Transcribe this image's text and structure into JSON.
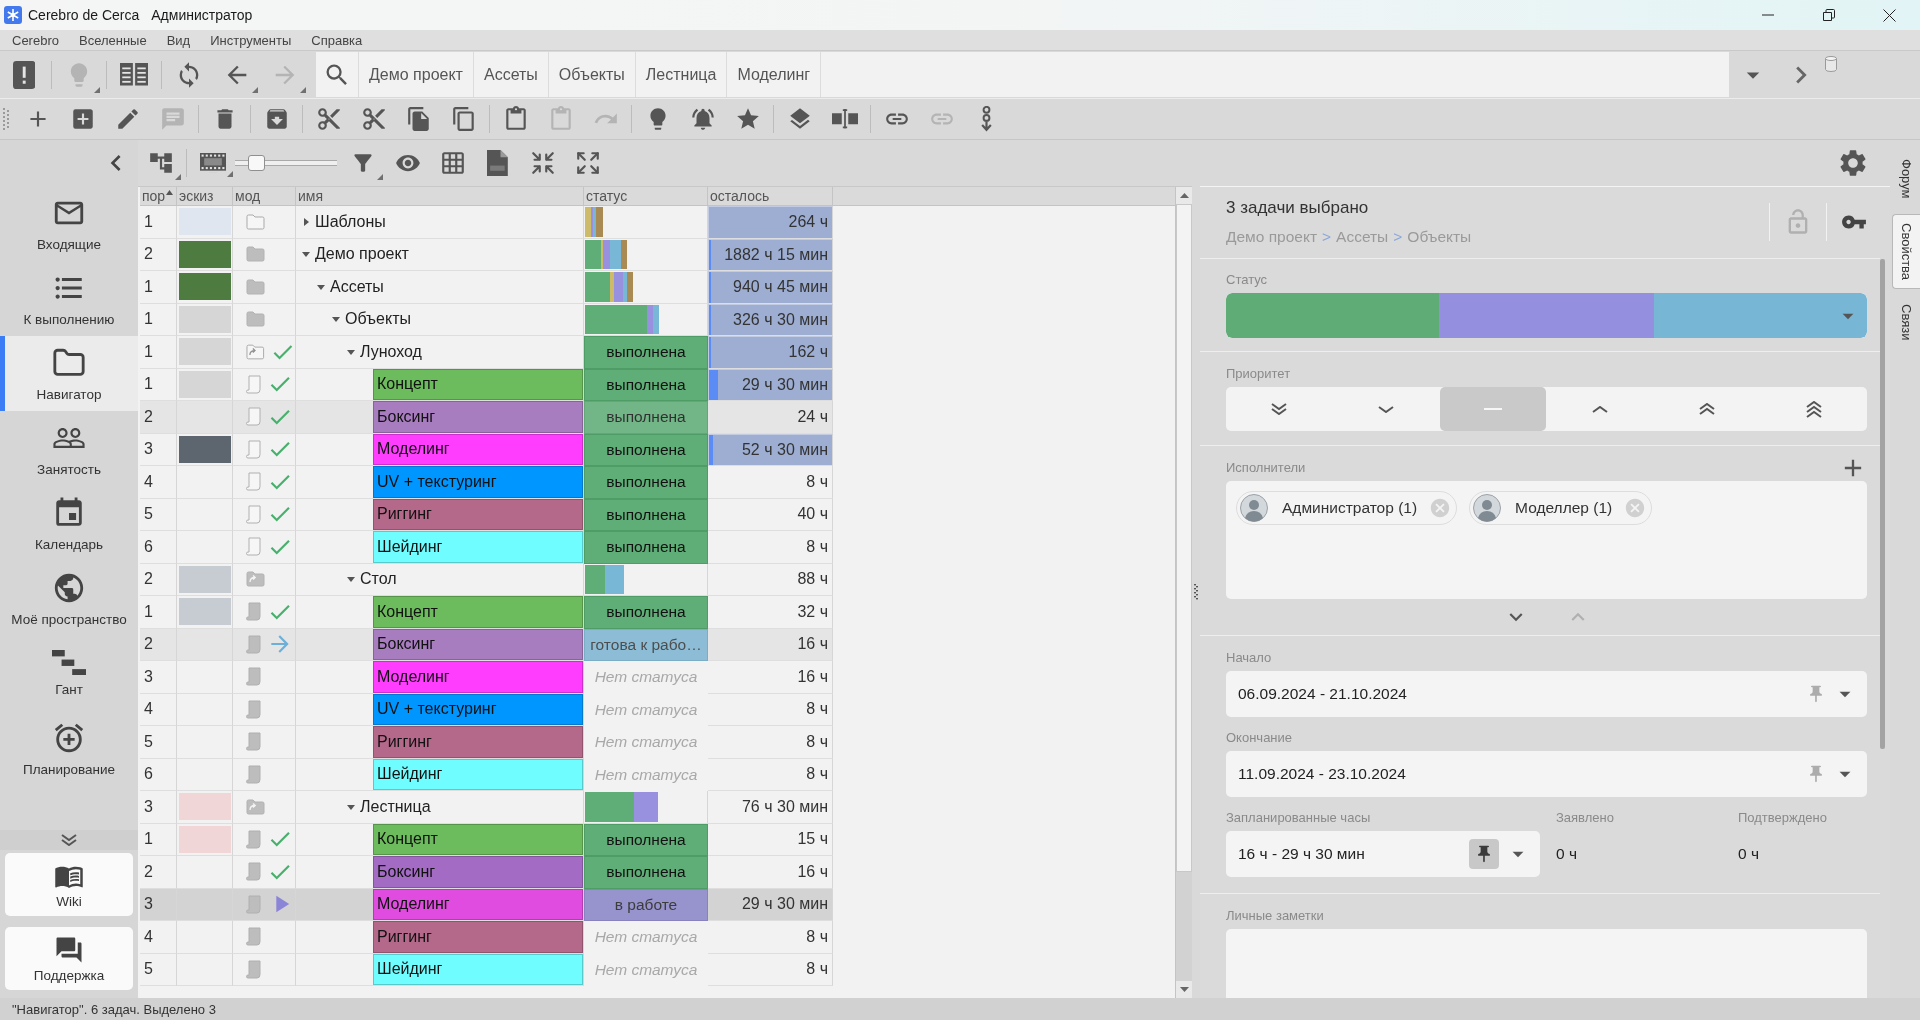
{
  "window": {
    "app_name": "Cerebro de Cerca",
    "user": "Администратор"
  },
  "menu": [
    "Cerebro",
    "Вселенные",
    "Вид",
    "Инструменты",
    "Справка"
  ],
  "nav_toolbar": {
    "groups": [
      [
        {
          "kind": "alert-book",
          "disabled": false,
          "dropdown": false
        }
      ],
      [
        {
          "kind": "bulb",
          "disabled": true,
          "dropdown": true
        }
      ],
      [
        {
          "kind": "reader",
          "disabled": false,
          "dropdown": false
        }
      ],
      [
        {
          "kind": "sync",
          "disabled": false,
          "dropdown": false
        },
        {
          "kind": "back",
          "disabled": false,
          "dropdown": true
        },
        {
          "kind": "forward",
          "disabled": true,
          "dropdown": true
        }
      ]
    ],
    "path": [
      "Демо проект",
      "Ассеты",
      "Объекты",
      "Лестница",
      "Моделинг"
    ]
  },
  "action_toolbar": {
    "groups": [
      [
        {
          "kind": "plus",
          "disabled": false,
          "dropdown": false
        },
        {
          "kind": "add-sub",
          "disabled": false,
          "dropdown": false
        },
        {
          "kind": "pencil",
          "disabled": false,
          "dropdown": false
        },
        {
          "kind": "comment",
          "disabled": true,
          "dropdown": false
        }
      ],
      [
        {
          "kind": "trash",
          "disabled": false,
          "dropdown": false
        }
      ],
      [
        {
          "kind": "archive",
          "disabled": false,
          "dropdown": false
        }
      ],
      [
        {
          "kind": "cut",
          "disabled": false,
          "dropdown": false
        },
        {
          "kind": "cut-move",
          "disabled": false,
          "dropdown": false
        },
        {
          "kind": "copy",
          "disabled": false,
          "dropdown": false
        },
        {
          "kind": "copy-link",
          "disabled": false,
          "dropdown": false
        }
      ],
      [
        {
          "kind": "paste",
          "disabled": false,
          "dropdown": false
        },
        {
          "kind": "paste-special",
          "disabled": true,
          "dropdown": false
        },
        {
          "kind": "redo",
          "disabled": true,
          "dropdown": false
        }
      ],
      [
        {
          "kind": "bulb",
          "disabled": false,
          "dropdown": false
        },
        {
          "kind": "bell",
          "disabled": false,
          "dropdown": false
        },
        {
          "kind": "star",
          "disabled": false,
          "dropdown": false
        }
      ],
      [
        {
          "kind": "stack",
          "disabled": false,
          "dropdown": false
        },
        {
          "kind": "split",
          "disabled": false,
          "dropdown": false
        }
      ],
      [
        {
          "kind": "link-add",
          "disabled": false,
          "dropdown": false
        },
        {
          "kind": "link",
          "disabled": true,
          "dropdown": false
        },
        {
          "kind": "chain-down",
          "disabled": false,
          "dropdown": false
        }
      ]
    ]
  },
  "view_toolbar": {
    "groups": [
      [
        {
          "kind": "tree",
          "disabled": false,
          "dropdown": true
        }
      ],
      [
        {
          "kind": "film",
          "disabled": false,
          "dropdown": true
        },
        {
          "kind": "zoom",
          "level": 0.15
        },
        {
          "kind": "filter",
          "disabled": false,
          "dropdown": true
        },
        {
          "kind": "eye",
          "disabled": false,
          "dropdown": false
        },
        {
          "kind": "grid",
          "disabled": false,
          "dropdown": false
        },
        {
          "kind": "xls",
          "disabled": false,
          "dropdown": false
        },
        {
          "kind": "compress",
          "disabled": false,
          "dropdown": false
        },
        {
          "kind": "expand",
          "disabled": false,
          "dropdown": false
        }
      ]
    ]
  },
  "sidebar": {
    "items": [
      {
        "kind": "inbox",
        "label": "Входящие",
        "selected": false
      },
      {
        "kind": "tasks",
        "label": "К выполнению",
        "selected": false
      },
      {
        "kind": "navigator",
        "label": "Навигатор",
        "selected": true
      },
      {
        "kind": "workload",
        "label": "Занятость",
        "selected": false
      },
      {
        "kind": "calendar",
        "label": "Календарь",
        "selected": false
      },
      {
        "kind": "space",
        "label": "Моё пространство",
        "selected": false
      },
      {
        "kind": "gantt",
        "label": "Гант",
        "selected": false
      },
      {
        "kind": "planning",
        "label": "Планирование",
        "selected": false
      }
    ],
    "links": [
      {
        "kind": "wiki",
        "label": "Wiki"
      },
      {
        "kind": "support",
        "label": "Поддержка"
      }
    ]
  },
  "table": {
    "columns": [
      {
        "label": "пор",
        "sorted": true
      },
      {
        "label": "эскиз",
        "sorted": false
      },
      {
        "label": "мод",
        "sorted": false
      },
      {
        "label": "имя",
        "sorted": false
      },
      {
        "label": "статус",
        "sorted": false
      },
      {
        "label": "осталось",
        "sorted": false
      }
    ],
    "rows": [
      {
        "order": "1",
        "thumbnail": {
          "kind": "shuttle"
        },
        "kind": "folder",
        "outline": true,
        "name": "Шаблоны",
        "expanded": false,
        "status_mix": [
          {
            "color": "#cdbb6a",
            "level": 0.05
          },
          {
            "color": "#9891e0",
            "level": 0.02
          },
          {
            "color": "#79b7d7",
            "level": 0.02
          },
          {
            "color": "#a88a52",
            "level": 0.055
          }
        ],
        "remaining": {
          "text": "264 ч",
          "highlighted": true
        },
        "selected": false,
        "focused": false
      },
      {
        "order": "2",
        "thumbnail": {
          "kind": "forest"
        },
        "kind": "folder",
        "outline": false,
        "name": "Демо проект",
        "expanded": true,
        "status_mix": [
          {
            "color": "#5fad77",
            "level": 0.13
          },
          {
            "color": "#cdbb6a",
            "level": 0.02
          },
          {
            "color": "#9891e0",
            "level": 0.06
          },
          {
            "color": "#79b7d7",
            "level": 0.09
          },
          {
            "color": "#a88a52",
            "level": 0.05
          }
        ],
        "remaining": {
          "text": "1882 ч 15 мин",
          "highlighted": true,
          "level": 0.02
        },
        "selected": false,
        "focused": false,
        "children": [
          {
            "order": "1",
            "thumbnail": {
              "kind": "forest"
            },
            "kind": "folder",
            "outline": false,
            "name": "Ассеты",
            "expanded": true,
            "status_mix": [
              {
                "color": "#5fad77",
                "level": 0.21
              },
              {
                "color": "#cdbb6a",
                "level": 0.03
              },
              {
                "color": "#9891e0",
                "level": 0.07
              },
              {
                "color": "#79b7d7",
                "level": 0.035
              },
              {
                "color": "#a88a52",
                "level": 0.055
              }
            ],
            "remaining": {
              "text": "940 ч 45 мин",
              "highlighted": true,
              "level": 0.02
            },
            "selected": false,
            "focused": false,
            "children": [
              {
                "order": "1",
                "thumbnail": {
                  "kind": "rover-sketch"
                },
                "kind": "folder",
                "outline": false,
                "name": "Объекты",
                "expanded": true,
                "status_mix": [
                  {
                    "color": "#5fad77",
                    "level": 0.51
                  },
                  {
                    "color": "#9891e0",
                    "level": 0.05
                  },
                  {
                    "color": "#79b7d7",
                    "level": 0.05
                  }
                ],
                "remaining": {
                  "text": "326 ч 30 мин",
                  "highlighted": true,
                  "level": 0.015
                },
                "selected": false,
                "focused": false,
                "children": [
                  {
                    "order": "1",
                    "thumbnail": {
                      "kind": "rover-sketch"
                    },
                    "kind": "linked-folder",
                    "outline": true,
                    "mark": {
                      "kind": "done"
                    },
                    "name": "Луноход",
                    "expanded": true,
                    "status": {
                      "text": "выполнена",
                      "kind": "done"
                    },
                    "remaining": {
                      "text": "162 ч",
                      "highlighted": true,
                      "level": 0.02
                    },
                    "selected": false,
                    "focused": false,
                    "children": [
                      {
                        "order": "1",
                        "thumbnail": {
                          "kind": "rover-sketch"
                        },
                        "kind": "task",
                        "outline": true,
                        "mark": {
                          "kind": "done"
                        },
                        "name": "Концепт",
                        "color": "#6cbb5c",
                        "status": {
                          "text": "выполнена",
                          "kind": "done"
                        },
                        "remaining": {
                          "text": "29 ч 30 мин",
                          "highlighted": true,
                          "level": 0.07
                        },
                        "selected": false,
                        "focused": false
                      },
                      {
                        "order": "2",
                        "kind": "task",
                        "outline": true,
                        "mark": {
                          "kind": "done"
                        },
                        "name": "Боксинг",
                        "color": "#a87dbf",
                        "status": {
                          "text": "выполнена",
                          "kind": "done"
                        },
                        "remaining": {
                          "text": "24 ч",
                          "highlighted": false
                        },
                        "selected": true,
                        "focused": false
                      },
                      {
                        "order": "3",
                        "thumbnail": {
                          "kind": "rover-photo"
                        },
                        "kind": "task",
                        "outline": true,
                        "mark": {
                          "kind": "done"
                        },
                        "name": "Моделинг",
                        "color": "#ff3dff",
                        "status": {
                          "text": "выполнена",
                          "kind": "done"
                        },
                        "remaining": {
                          "text": "52 ч 30 мин",
                          "highlighted": true,
                          "level": 0.035
                        },
                        "selected": false,
                        "focused": false
                      },
                      {
                        "order": "4",
                        "kind": "task",
                        "outline": true,
                        "mark": {
                          "kind": "done"
                        },
                        "name": "UV + текстуринг",
                        "color": "#0096ff",
                        "status": {
                          "text": "выполнена",
                          "kind": "done"
                        },
                        "remaining": {
                          "text": "8 ч",
                          "highlighted": false
                        },
                        "selected": false,
                        "focused": false
                      },
                      {
                        "order": "5",
                        "kind": "task",
                        "outline": true,
                        "mark": {
                          "kind": "done"
                        },
                        "name": "Риггинг",
                        "color": "#b5698a",
                        "status": {
                          "text": "выполнена",
                          "kind": "done"
                        },
                        "remaining": {
                          "text": "40 ч",
                          "highlighted": false
                        },
                        "selected": false,
                        "focused": false
                      },
                      {
                        "order": "6",
                        "kind": "task",
                        "outline": true,
                        "mark": {
                          "kind": "done"
                        },
                        "name": "Шейдинг",
                        "color": "#70fdff",
                        "status": {
                          "text": "выполнена",
                          "kind": "done"
                        },
                        "remaining": {
                          "text": "8 ч",
                          "highlighted": false
                        },
                        "selected": false,
                        "focused": false
                      }
                    ]
                  },
                  {
                    "order": "2",
                    "thumbnail": {
                      "kind": "room"
                    },
                    "kind": "linked-folder",
                    "outline": false,
                    "name": "Стол",
                    "expanded": true,
                    "status_mix": [
                      {
                        "color": "#5fad77",
                        "level": 0.165
                      },
                      {
                        "color": "#79b7d7",
                        "level": 0.16
                      }
                    ],
                    "remaining": {
                      "text": "88 ч",
                      "highlighted": false
                    },
                    "selected": false,
                    "focused": false,
                    "children": [
                      {
                        "order": "1",
                        "thumbnail": {
                          "kind": "room"
                        },
                        "kind": "task",
                        "outline": false,
                        "mark": {
                          "kind": "done"
                        },
                        "name": "Концепт",
                        "color": "#6cbb5c",
                        "status": {
                          "text": "выполнена",
                          "kind": "done"
                        },
                        "remaining": {
                          "text": "32 ч",
                          "highlighted": false
                        },
                        "selected": false,
                        "focused": false
                      },
                      {
                        "order": "2",
                        "kind": "task",
                        "outline": false,
                        "mark": {
                          "kind": "ready"
                        },
                        "name": "Боксинг",
                        "color": "#a87dbf",
                        "status": {
                          "text": "готова к рабо…",
                          "kind": "ready"
                        },
                        "remaining": {
                          "text": "16 ч",
                          "highlighted": false
                        },
                        "selected": true,
                        "focused": false
                      },
                      {
                        "order": "3",
                        "kind": "task",
                        "outline": false,
                        "name": "Моделинг",
                        "color": "#ff3dff",
                        "status": {
                          "text": "Нет статуса",
                          "kind": "none"
                        },
                        "remaining": {
                          "text": "16 ч",
                          "highlighted": false
                        },
                        "selected": false,
                        "focused": false
                      },
                      {
                        "order": "4",
                        "kind": "task",
                        "outline": false,
                        "name": "UV + текстуринг",
                        "color": "#0096ff",
                        "status": {
                          "text": "Нет статуса",
                          "kind": "none"
                        },
                        "remaining": {
                          "text": "8 ч",
                          "highlighted": false
                        },
                        "selected": false,
                        "focused": false
                      },
                      {
                        "order": "5",
                        "kind": "task",
                        "outline": false,
                        "name": "Риггинг",
                        "color": "#b5698a",
                        "status": {
                          "text": "Нет статуса",
                          "kind": "none"
                        },
                        "remaining": {
                          "text": "8 ч",
                          "highlighted": false
                        },
                        "selected": false,
                        "focused": false
                      },
                      {
                        "order": "6",
                        "kind": "task",
                        "outline": false,
                        "name": "Шейдинг",
                        "color": "#70fdff",
                        "status": {
                          "text": "Нет статуса",
                          "kind": "none"
                        },
                        "remaining": {
                          "text": "8 ч",
                          "highlighted": false
                        },
                        "selected": false,
                        "focused": false
                      }
                    ]
                  },
                  {
                    "order": "3",
                    "thumbnail": {
                      "kind": "ladder"
                    },
                    "kind": "linked-folder",
                    "outline": false,
                    "name": "Лестница",
                    "expanded": true,
                    "status_mix": [
                      {
                        "color": "#5fad77",
                        "level": 0.405
                      },
                      {
                        "color": "#9891e0",
                        "level": 0.2
                      }
                    ],
                    "remaining": {
                      "text": "76 ч 30 мин",
                      "highlighted": false
                    },
                    "selected": false,
                    "focused": false,
                    "children": [
                      {
                        "order": "1",
                        "thumbnail": {
                          "kind": "ladder"
                        },
                        "kind": "task",
                        "outline": false,
                        "mark": {
                          "kind": "done"
                        },
                        "name": "Концепт",
                        "color": "#6cbb5c",
                        "status": {
                          "text": "выполнена",
                          "kind": "done"
                        },
                        "remaining": {
                          "text": "15 ч",
                          "highlighted": false
                        },
                        "selected": false,
                        "focused": false
                      },
                      {
                        "order": "2",
                        "kind": "task",
                        "outline": false,
                        "mark": {
                          "kind": "done"
                        },
                        "name": "Боксинг",
                        "color": "#a36bc4",
                        "status": {
                          "text": "выполнена",
                          "kind": "done"
                        },
                        "remaining": {
                          "text": "16 ч",
                          "highlighted": false
                        },
                        "selected": false,
                        "focused": false
                      },
                      {
                        "order": "3",
                        "kind": "task",
                        "outline": false,
                        "mark": {
                          "kind": "active"
                        },
                        "name": "Моделинг",
                        "color": "#e14ce0",
                        "status": {
                          "text": "в работе",
                          "kind": "active"
                        },
                        "remaining": {
                          "text": "29 ч 30 мин",
                          "highlighted": false
                        },
                        "selected": true,
                        "focused": true
                      },
                      {
                        "order": "4",
                        "kind": "task",
                        "outline": false,
                        "name": "Риггинг",
                        "color": "#b5698a",
                        "status": {
                          "text": "Нет статуса",
                          "kind": "none"
                        },
                        "remaining": {
                          "text": "8 ч",
                          "highlighted": false
                        },
                        "selected": false,
                        "focused": false
                      },
                      {
                        "order": "5",
                        "kind": "task",
                        "outline": false,
                        "name": "Шейдинг",
                        "color": "#70fdff",
                        "status": {
                          "text": "Нет статуса",
                          "kind": "none"
                        },
                        "remaining": {
                          "text": "8 ч",
                          "highlighted": false
                        },
                        "selected": false,
                        "focused": false
                      }
                    ]
                  }
                ]
              }
            ]
          }
        ]
      }
    ]
  },
  "details": {
    "title": "3 задачи выбрано",
    "path": [
      {
        "text": "Демо проект",
        "kind": "crumb"
      },
      {
        "text": ">",
        "kind": "separator"
      },
      {
        "text": "Ассеты",
        "kind": "crumb"
      },
      {
        "text": ">",
        "kind": "separator"
      },
      {
        "text": "Объекты",
        "kind": "crumb"
      }
    ],
    "locked": false,
    "status": {
      "label": "Статус",
      "segments": [
        {
          "color": "#5fac77",
          "level": 0.333
        },
        {
          "color": "#958fdf",
          "level": 0.334
        },
        {
          "color": "#78b6d6",
          "level": 0.333
        }
      ]
    },
    "priority": {
      "label": "Приоритет",
      "options": [
        {
          "kind": "lowest",
          "selected": false
        },
        {
          "kind": "low",
          "selected": false
        },
        {
          "kind": "normal",
          "selected": true
        },
        {
          "kind": "high",
          "selected": false
        },
        {
          "kind": "higher",
          "selected": false
        },
        {
          "kind": "highest",
          "selected": false
        }
      ]
    },
    "assignees": {
      "label": "Исполнители",
      "people": [
        {
          "name": "Администратор (1)"
        },
        {
          "name": "Моделлер (1)"
        }
      ],
      "more": {
        "disabled": false
      },
      "less": {
        "disabled": true
      }
    },
    "start": {
      "label": "Начало",
      "value": "06.09.2024 - 21.10.2024",
      "pinned": false
    },
    "end": {
      "label": "Окончание",
      "value": "11.09.2024 - 23.10.2024",
      "pinned": false
    },
    "planned": {
      "label": "Запланированные часы",
      "value": "16 ч - 29 ч 30 мин",
      "pinned": true
    },
    "reported": {
      "label": "Заявлено",
      "value": "0 ч"
    },
    "confirmed": {
      "label": "Подтверждено",
      "value": "0 ч"
    },
    "notes": {
      "label": "Личные заметки"
    }
  },
  "side_tabs": [
    {
      "label": "Форум",
      "selected": false
    },
    {
      "label": "Свойства",
      "selected": true
    },
    {
      "label": "Связи",
      "selected": false
    }
  ],
  "status_bar": "\"Навигатор\". 6 задач. Выделено 3"
}
